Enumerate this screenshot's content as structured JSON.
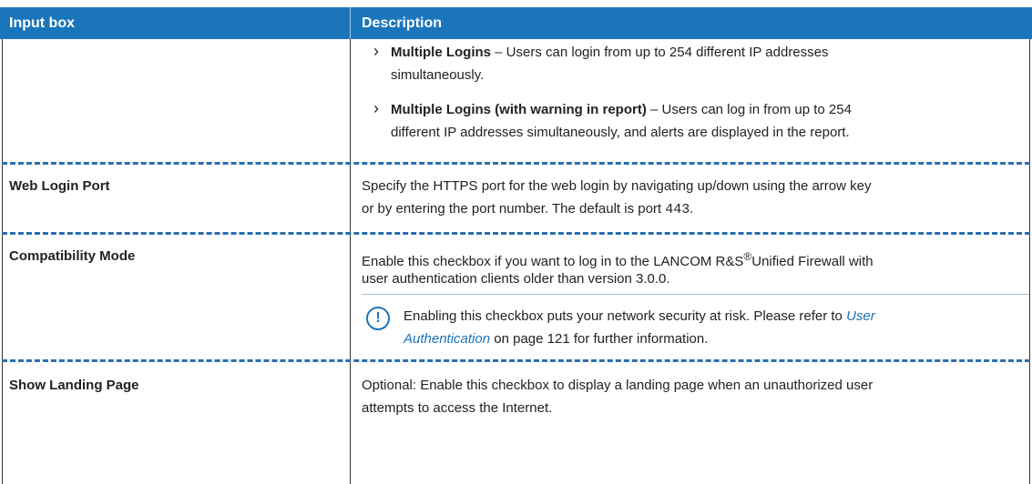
{
  "header": {
    "col1": "Input box",
    "col2": "Description"
  },
  "rows": {
    "multi": {
      "item1_bold": "Multiple Logins",
      "item1_text_line1": "– Users can login from up to 254 different IP addresses",
      "item1_text_line2": "simultaneously.",
      "item2_bold": "Multiple Logins (with warning in report)",
      "item2_text_line1": "– Users can log in from up to 254",
      "item2_text_line2": "different IP addresses simultaneously, and alerts are displayed in the report."
    },
    "web_login_port": {
      "label": "Web Login Port",
      "line1": "Specify the HTTPS port for the web login by navigating up/down using the arrow key",
      "line2_prefix": "or by entering the port number. The default is port",
      "port": "443",
      "line2_suffix": "."
    },
    "compat": {
      "label": "Compatibility Mode",
      "line1_prefix": "Enable this checkbox if you want to log in to the LANCOM R&S",
      "registered": "®",
      "line1_suffix": "Unified Firewall with",
      "line2": "user authentication clients older than version 3.0.0.",
      "note_line1_prefix": "Enabling this checkbox puts your network security at risk. Please refer to",
      "note_link_part1": "User",
      "note_link_part2": "Authentication",
      "note_line2_suffix": "on page 121 for further information."
    },
    "landing": {
      "label": "Show Landing Page",
      "line1": "Optional: Enable this checkbox to display a landing page when an unauthorized user",
      "line2": "attempts to access the Internet."
    }
  },
  "icons": {
    "bullet": "chevron-right-icon",
    "warning": "exclamation-circle-icon"
  },
  "colors": {
    "header_bg": "#1b75bb",
    "link": "#1b75bb",
    "divider": "#2a6fb0"
  }
}
